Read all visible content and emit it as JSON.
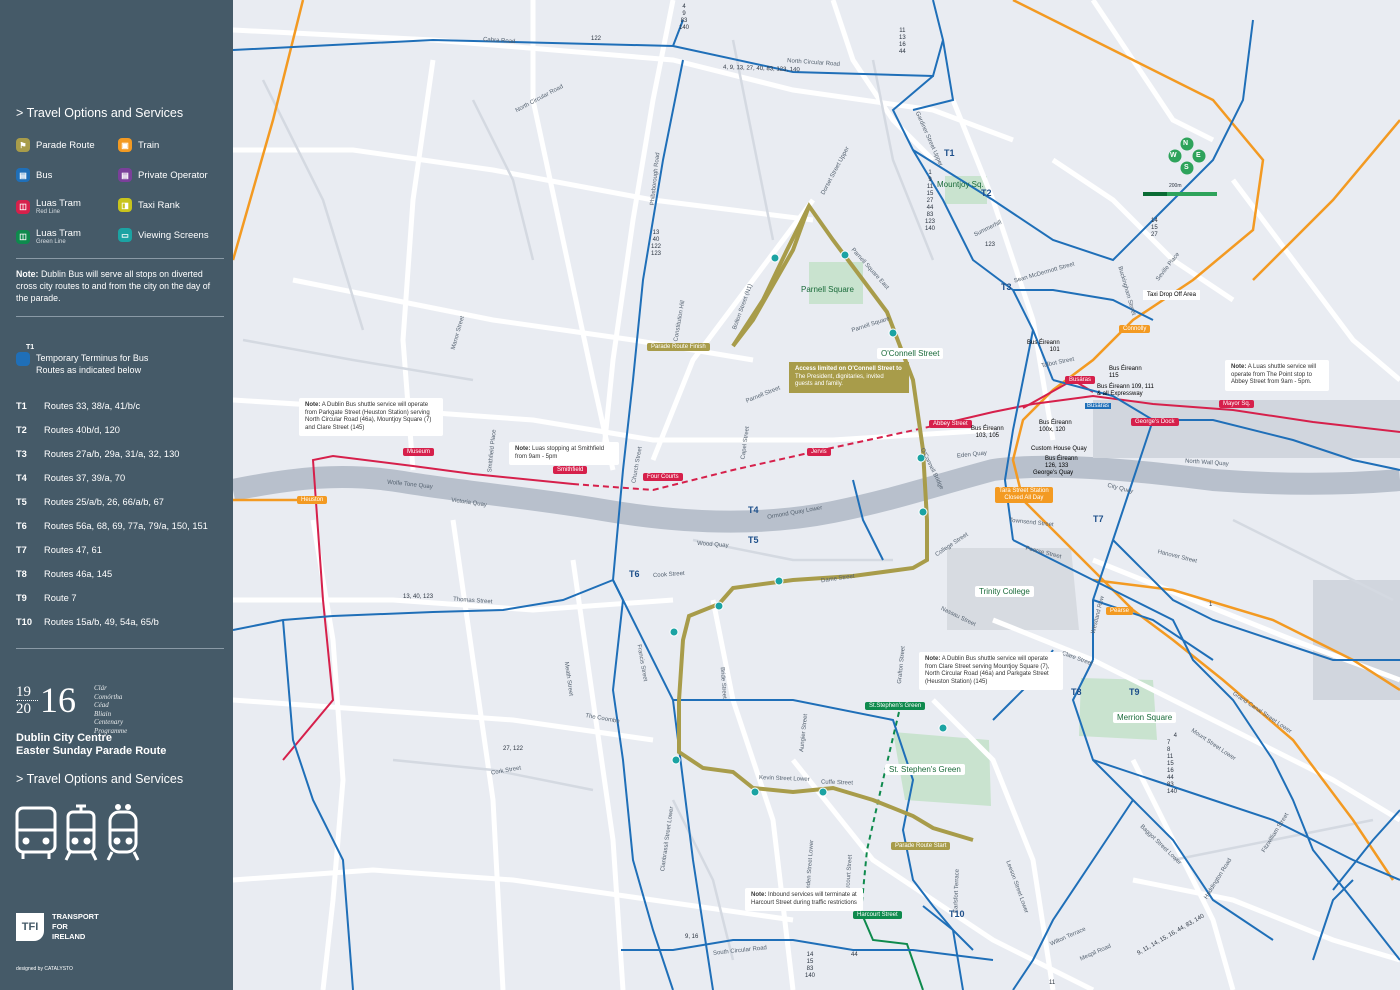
{
  "sidebar": {
    "heading": "Travel Options and Services",
    "legend": [
      {
        "label": "Parade Route",
        "sub": "",
        "color": "#a89c4a",
        "icon": "flag-icon"
      },
      {
        "label": "Train",
        "sub": "",
        "color": "#f39a22",
        "icon": "train-icon"
      },
      {
        "label": "Bus",
        "sub": "",
        "color": "#1f6fb8",
        "icon": "bus-icon"
      },
      {
        "label": "Private Operator",
        "sub": "",
        "color": "#7b3f9a",
        "icon": "bus-icon"
      },
      {
        "label": "Luas Tram",
        "sub": "Red Line",
        "color": "#d6204b",
        "icon": "tram-icon"
      },
      {
        "label": "Taxi Rank",
        "sub": "",
        "color": "#c8c41c",
        "icon": "taxi-icon"
      },
      {
        "label": "Luas Tram",
        "sub": "Green Line",
        "color": "#0e8a4d",
        "icon": "tram-icon"
      },
      {
        "label": "Viewing Screens",
        "sub": "",
        "color": "#1ba3a3",
        "icon": "screen-icon"
      }
    ],
    "note_bold": "Note:",
    "note_text": "Dublin Bus will serve all stops on diverted cross city routes to and from the city on the day of the parade.",
    "terminus_sup": "T1",
    "terminus_text": "Temporary Terminus for Bus Routes as indicated below",
    "routes": [
      {
        "code": "T1",
        "text": "Routes 33, 38/a, 41/b/c"
      },
      {
        "code": "T2",
        "text": "Routes 40b/d, 120"
      },
      {
        "code": "T3",
        "text": "Routes 27a/b, 29a, 31/a, 32, 130"
      },
      {
        "code": "T4",
        "text": "Routes 37, 39/a, 70"
      },
      {
        "code": "T5",
        "text": "Routes 25/a/b, 26, 66/a/b, 67"
      },
      {
        "code": "T6",
        "text": "Routes 56a, 68, 69, 77a, 79/a, 150, 151"
      },
      {
        "code": "T7",
        "text": "Routes 47, 61"
      },
      {
        "code": "T8",
        "text": "Routes 46a, 145"
      },
      {
        "code": "T9",
        "text": "Route 7"
      },
      {
        "code": "T10",
        "text": "Routes 15a/b, 49, 54a, 65/b"
      }
    ],
    "logo_top": "19",
    "logo_bottom": "20",
    "logo_big": "16",
    "logo_lines": [
      "Clár Comórtha",
      "Céad Bliain",
      "Centenary",
      "Programme"
    ],
    "title_line1": "Dublin City Centre",
    "title_line2": "Easter Sunday Parade Route",
    "heading2": "Travel Options and Services",
    "tfi_mark": "TFI",
    "tfi_lines": [
      "TRANSPORT",
      "FOR",
      "IRELAND"
    ],
    "designed_by": "designed by  CATALYSTO"
  },
  "map": {
    "streets": [
      "Cabra Road",
      "North Circular Road",
      "North Circular Road",
      "Phibsborough Road",
      "Dorset Street Upper",
      "Parnell Square East",
      "Parnell Square",
      "Gardiner Street Upper",
      "Summerhill",
      "Constitution Hill",
      "Bolton Street (N1)",
      "Parnell Street",
      "Capel Street",
      "Church Street",
      "Smithfield Place",
      "Manor Street",
      "Wolfe Tone Quay",
      "Victoria Quay",
      "Ormond Quay Lower",
      "Wood Quay",
      "Cook Street",
      "Dame Street",
      "Thomas Street",
      "Meath Street",
      "Francis Street",
      "The Coombe",
      "Cork Street",
      "Clanbrassil Street Lower",
      "Bride Street",
      "Aungier Street",
      "Kevin Street Lower",
      "Cuffe Street",
      "Camden Street Lower",
      "Harcourt Street",
      "Earlsfort Terrace",
      "Leeson Street Lower",
      "Grafton Street",
      "Nassau Street",
      "College Street",
      "Pearse Street",
      "Townsend Street",
      "Westland Row",
      "Clare Street",
      "Hanover Street",
      "Grand Canal Street Lower",
      "Mount Street Lower",
      "Baggot Street Lower",
      "Fitzwilliam Street",
      "Haddington Road",
      "Mespil Road",
      "Wilton Terrace",
      "Sean McDermott Street",
      "Buckingham Street",
      "Seville Place",
      "Talbot Street",
      "Eden Quay",
      "O'Connell Bridge",
      "North Wall Quay",
      "City Quay",
      "South Circular Road",
      "Custom House Quay"
    ],
    "street_labels": {
      "cabra": "Cabra Road",
      "ncr": "North Circular Road",
      "ncr2": "North Circular Road",
      "phib": "Phibsborough Road",
      "dorset": "Dorset Street Upper",
      "pse": "Parnell Square East",
      "psq": "Parnell Square",
      "gardiner": "Gardiner Street Upper",
      "summer": "Summerhill",
      "const": "Constitution Hill",
      "bolton": "Bolton Street (N1)",
      "parnell": "Parnell Street",
      "capel": "Capel Street",
      "church": "Church Street",
      "smithfield": "Smithfield Place",
      "manor": "Manor Street",
      "wolfe": "Wolfe Tone Quay",
      "victoria": "Victoria Quay",
      "ormond": "Ormond Quay Lower",
      "wood": "Wood Quay",
      "cook": "Cook Street",
      "dame": "Dame Street",
      "thomas": "Thomas Street",
      "meath": "Meath Street",
      "francis": "Francis Street",
      "coombe": "The Coombe",
      "cork": "Cork Street",
      "clanbrassil": "Clanbrassil Street Lower",
      "bride": "Bride Street",
      "aungier": "Aungier Street",
      "kevin": "Kevin Street Lower",
      "cuffe": "Cuffe Street",
      "camden": "Camden Street Lower",
      "harcourt": "Harcourt Street",
      "earlsfort": "Earlsfort Terrace",
      "leeson": "Leeson Street Lower",
      "grafton": "Grafton Street",
      "nassau": "Nassau Street",
      "college": "College Street",
      "pearse": "Pearse Street",
      "townsend": "Townsend Street",
      "westland": "Westland Row",
      "clare": "Clare Street",
      "hanover": "Hanover Street",
      "grandcanal": "Grand Canal Street Lower",
      "mount": "Mount Street Lower",
      "baggot": "Baggot Street Lower",
      "fitz": "Fitzwilliam Street",
      "haddington": "Haddington Road",
      "mespil": "Mespil Road",
      "wilton": "Wilton Terrace",
      "seanmc": "Sean McDermott Street",
      "buckingham": "Buckingham Street",
      "seville": "Seville Place",
      "talbot": "Talbot Street",
      "eden": "Eden Quay",
      "oconnellbr": "O'Connell Bridge",
      "northwall": "North Wall Quay",
      "cityquay": "City Quay",
      "scr": "South Circular Road",
      "customhouse": "Custom House Quay"
    },
    "places": {
      "mountjoy": "Mountjoy Sq.",
      "parnell_sq": "Parnell Square",
      "oconnell": "O'Connell Street",
      "trinity": "Trinity College",
      "merrion": "Merrion Square",
      "stephens": "St. Stephen's Green"
    },
    "luas_red": {
      "museum": "Museum",
      "smithfield": "Smithfield",
      "four_courts": "Four Courts",
      "jervis": "Jervis",
      "abbey": "Abbey Street",
      "busaras": "Busáras",
      "georges_dock": "George's Dock",
      "mayor": "Mayor Sq."
    },
    "luas_green": {
      "stephens": "St.Stephen's Green",
      "harcourt": "Harcourt Street"
    },
    "trains": {
      "heuston": "Heuston",
      "connolly": "Connolly",
      "tara": "Tara Street Station",
      "tara_note": "Closed All Day",
      "pearse": "Pearse"
    },
    "parade": {
      "finish": "Parade Route Finish",
      "start": "Parade Route Start"
    },
    "terminals": {
      "t1": "T1",
      "t2": "T2",
      "t3": "T3",
      "t4": "T4",
      "t5": "T5",
      "t6": "T6",
      "t7": "T7",
      "t8": "T8",
      "t9": "T9",
      "t10": "T10"
    },
    "bus_eireann": {
      "be101": "Bus Éireann\n101",
      "be115": "Bus Éireann\n115",
      "be109": "Bus Éireann 109, 111\n& all Expressway",
      "be103": "Bus Éireann\n103, 105",
      "be100": "Bus Éireann\n100x, 120",
      "be126": "Bus Éireann\n126, 133",
      "customhouse": "Custom House Quay",
      "georges": "George's Quay",
      "busaras_stop": "Busáras"
    },
    "taxi_drop": "Taxi Drop Off Area",
    "callouts": {
      "access_bold": "Access limited on O'Connell Street to",
      "access_text": "The President, dignitaries, invited guests and family.",
      "luas_point_bold": "Note:",
      "luas_point_text": "A Luas shuttle service will operate from The Point stop to Abbey Street from 9am - 5pm.",
      "parkgate_bold": "Note:",
      "parkgate_text": "A Dublin Bus shuttle service will operate from Parkgate Street (Heuston Station) serving North Circular Road (46a), Mountjoy Square (7) and Clare Street (145)",
      "smithfield_bold": "Note:",
      "smithfield_text": "Luas stopping at Smithfield from 9am - 5pm",
      "clare_bold": "Note:",
      "clare_text": "A Dublin Bus shuttle service will operate from Clare Street serving Mountjoy Square (7), North Circular Road (46a) and Parkgate Street (Heuston Station) (145)",
      "inbound_bold": "Note:",
      "inbound_text": "Inbound services will terminate at Harcourt Street during traffic restrictions"
    },
    "bus_numbers": {
      "top": "4\n9\n83\n140",
      "ncr": "4, 9, 13, 27, 40, 83, 123, 140",
      "cabra": "122",
      "n11": "11\n13\n16\n44",
      "mountjoy": "1\n9\n11\n15\n27\n44\n83\n123\n140",
      "phib": "13\n40\n122\n123",
      "summerhill": "123",
      "t14": "14\n15\n27",
      "thomas": "13, 40, 123",
      "cork": "27, 122",
      "mount": "4\n7\n8\n11\n15\n16\n44\n83\n140",
      "baggot": "9, 11, 14, 15, 16, 44, 83, 140",
      "scr": "9, 16",
      "camden": "14\n15\n83\n140",
      "n44": "44",
      "n1": "1",
      "n11b": "11"
    },
    "compass": {
      "n": "N",
      "e": "E",
      "s": "S",
      "w": "W",
      "scale": "200m"
    }
  }
}
